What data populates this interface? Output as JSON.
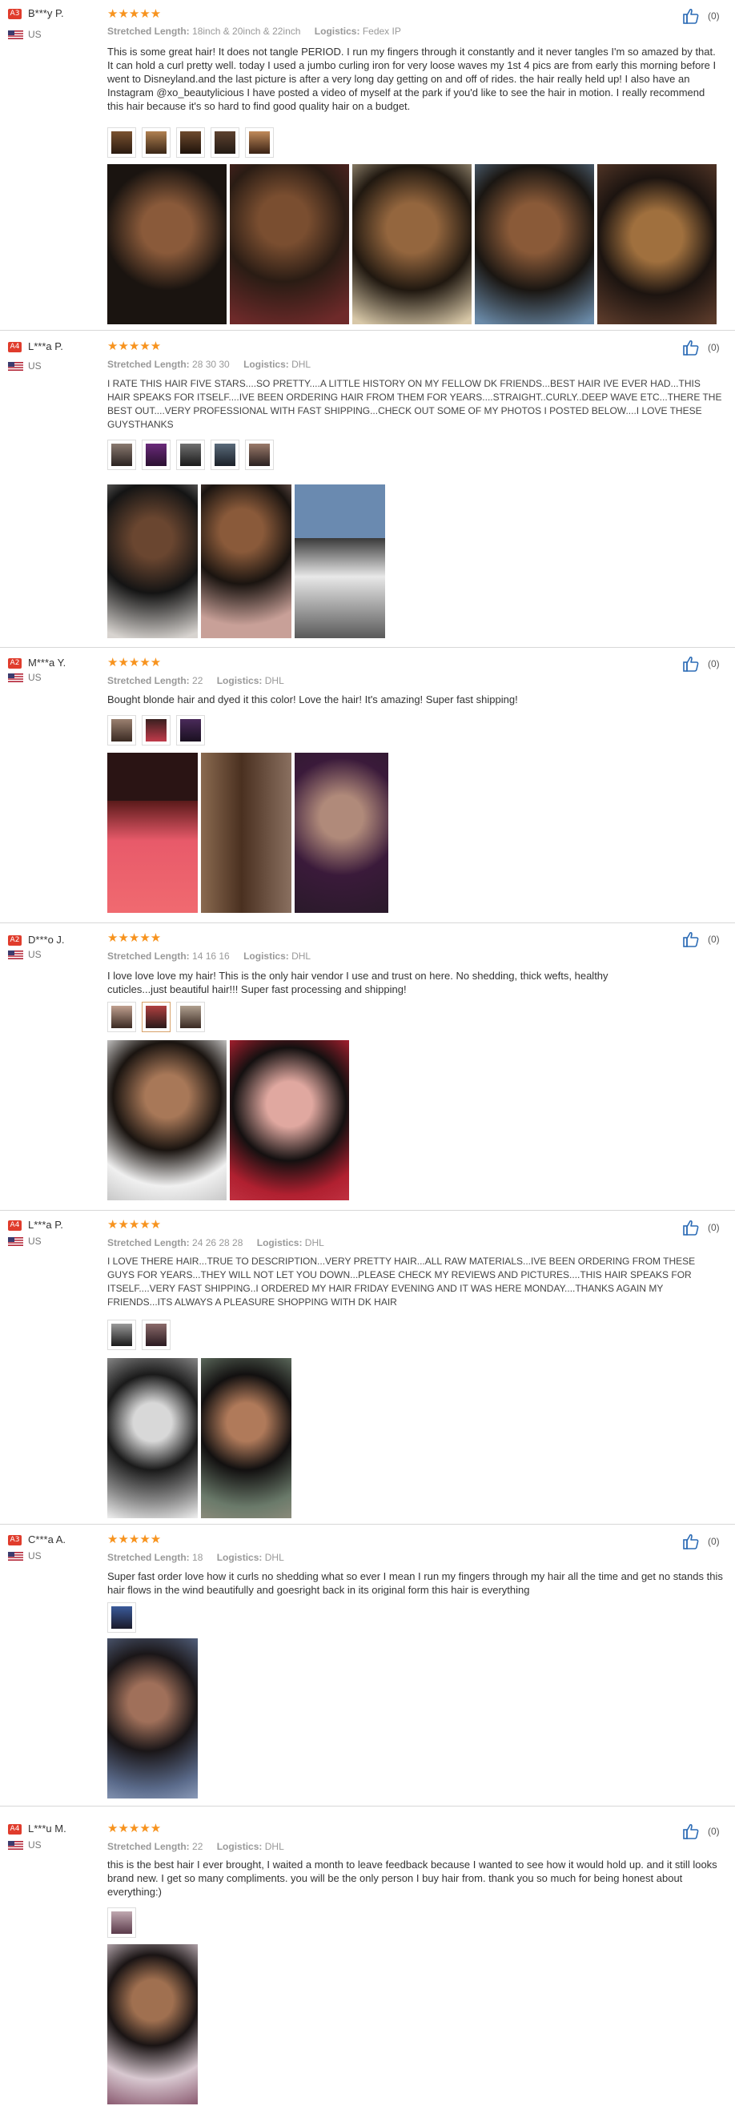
{
  "labels": {
    "stretched_length": "Stretched Length:",
    "logistics": "Logistics:"
  },
  "icons": {
    "star": "star-icon",
    "like": "thumbs-up-icon",
    "flag": "us-flag-icon"
  },
  "colors": {
    "star": "#f7931e",
    "badge": "#e03c2c",
    "like_icon": "#2b6bb5"
  },
  "reviews": [
    {
      "level": "A3",
      "name": "B***y P.",
      "country": "US",
      "rating": 5,
      "stars": "★★★★★",
      "length": "18inch & 20inch & 22inch",
      "logistics": "Fedex IP",
      "likes": "(0)",
      "text": "This is some great hair! It does not tangle PERIOD. I run my fingers through it constantly and it never tangles I'm so amazed by that. It can hold a curl pretty well. today I used a jumbo curling iron for very loose waves my 1st 4 pics are from early this morning before I went to Disneyland.and the last picture is after a very long day getting on and off of rides. the hair really held up! I also have an Instagram @xo_beautylicious I have posted a video of myself at the park if you'd like to see the hair in motion. I really recommend this hair because it's so hard to find good quality hair on a budget."
    },
    {
      "level": "A4",
      "name": "L***a P.",
      "country": "US",
      "rating": 5,
      "stars": "★★★★★",
      "length": "28 30 30",
      "logistics": "DHL",
      "likes": "(0)",
      "text": "I RATE THIS HAIR FIVE STARS....SO PRETTY....A LITTLE HISTORY ON MY FELLOW DK FRIENDS...BEST HAIR IVE EVER HAD...THIS HAIR SPEAKS FOR ITSELF....IVE BEEN ORDERING HAIR FROM THEM FOR YEARS....STRAIGHT..CURLY..DEEP WAVE ETC...THERE THE BEST OUT....VERY PROFESSIONAL WITH FAST SHIPPING...CHECK OUT SOME OF MY PHOTOS I POSTED BELOW....I LOVE THESE GUYSTHANKS"
    },
    {
      "level": "A2",
      "name": "M***a Y.",
      "country": "US",
      "rating": 5,
      "stars": "★★★★★",
      "length": "22",
      "logistics": "DHL",
      "likes": "(0)",
      "text": "Bought blonde hair and dyed it this color! Love the hair! It's amazing! Super fast shipping!"
    },
    {
      "level": "A2",
      "name": "D***o J.",
      "country": "US",
      "rating": 5,
      "stars": "★★★★★",
      "length": "14 16 16",
      "logistics": "DHL",
      "likes": "(0)",
      "text": "I love love love my hair! This is the only hair vendor  I use and trust on here. No shedding, thick wefts, healthy cuticles...just beautiful hair!!! Super fast  processing and shipping!"
    },
    {
      "level": "A4",
      "name": "L***a P.",
      "country": "US",
      "rating": 5,
      "stars": "★★★★★",
      "length": "24 26 28 28",
      "logistics": "DHL",
      "likes": "(0)",
      "text": "I LOVE THERE HAIR...TRUE TO DESCRIPTION...VERY PRETTY HAIR...ALL RAW MATERIALS...IVE BEEN ORDERING FROM THESE GUYS FOR YEARS...THEY WILL NOT LET YOU DOWN...PLEASE CHECK MY REVIEWS AND PICTURES....THIS HAIR SPEAKS FOR ITSELF....VERY FAST SHIPPING..I ORDERED MY HAIR FRIDAY EVENING AND IT WAS HERE MONDAY....THANKS AGAIN MY FRIENDS...ITS ALWAYS A PLEASURE SHOPPING WITH DK HAIR"
    },
    {
      "level": "A3",
      "name": "C***a A.",
      "country": "US",
      "rating": 5,
      "stars": "★★★★★",
      "length": "18",
      "logistics": "DHL",
      "likes": "(0)",
      "text": "Super fast order love how it curls no shedding what so ever I mean I run my fingers through my hair all the time and get no stands this hair flows in the wind beautifully and goesright back in its original form this hair is everything"
    },
    {
      "level": "A4",
      "name": "L***u M.",
      "country": "US",
      "rating": 5,
      "stars": "★★★★★",
      "length": "22",
      "logistics": "DHL",
      "likes": "(0)",
      "text": "this is the best hair I ever brought, I waited a month to leave feedback because I wanted to see  how it would hold up. and it still looks brand new. I  get so many compliments. you will be the only person I buy hair from. thank you so much for being honest about everything:)"
    }
  ]
}
